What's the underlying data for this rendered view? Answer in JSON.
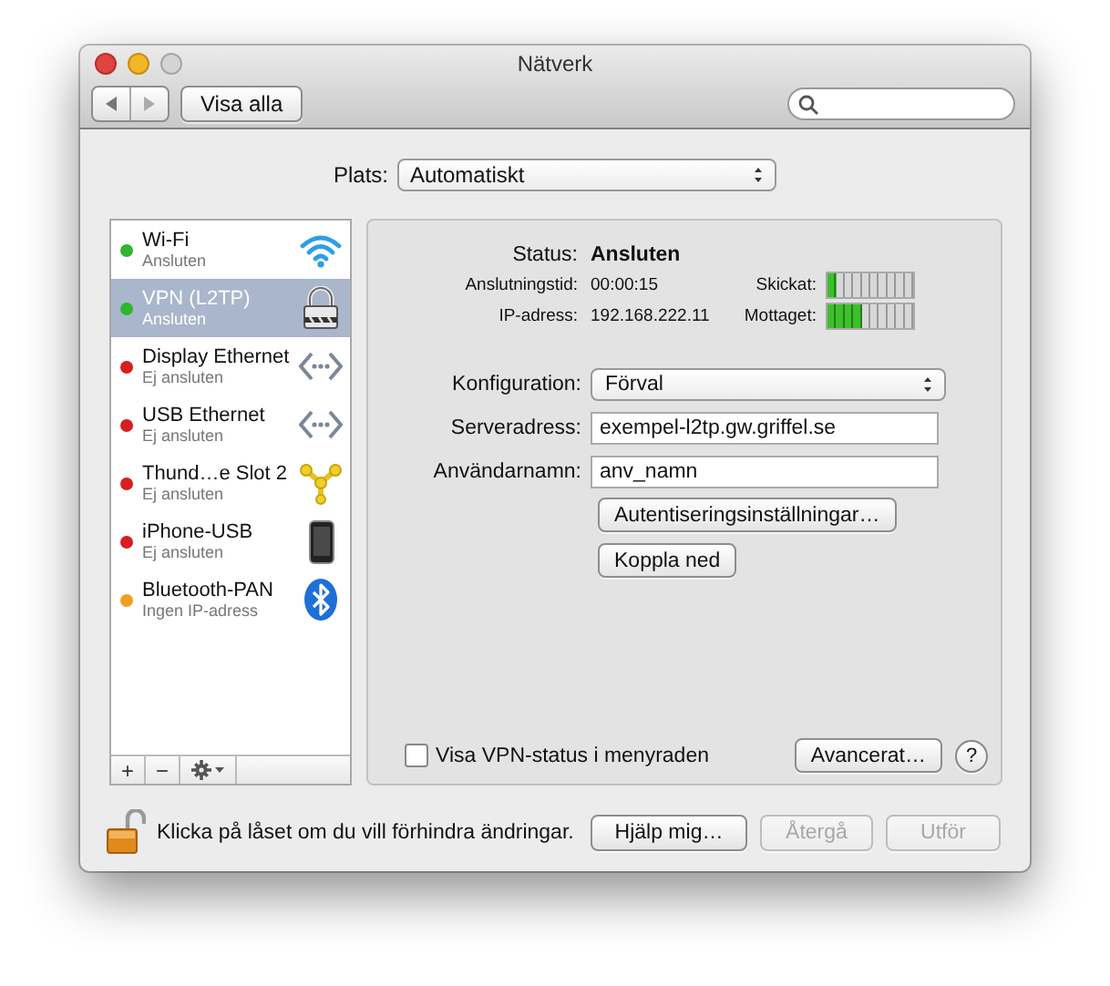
{
  "window": {
    "title": "Nätverk"
  },
  "toolbar": {
    "show_all": "Visa alla"
  },
  "location": {
    "label": "Plats:",
    "value": "Automatiskt"
  },
  "services": [
    {
      "name": "Wi-Fi",
      "status": "Ansluten",
      "color": "#2fb52f",
      "kind": "wifi",
      "selected": false
    },
    {
      "name": "VPN (L2TP)",
      "status": "Ansluten",
      "color": "#2fb52f",
      "kind": "vpn",
      "selected": true
    },
    {
      "name": "Display Ethernet",
      "status": "Ej ansluten",
      "color": "#d81e1e",
      "kind": "ethernet",
      "selected": false
    },
    {
      "name": "USB Ethernet",
      "status": "Ej ansluten",
      "color": "#d81e1e",
      "kind": "ethernet",
      "selected": false
    },
    {
      "name": "Thund…e Slot 2",
      "status": "Ej ansluten",
      "color": "#d81e1e",
      "kind": "firewire",
      "selected": false
    },
    {
      "name": "iPhone-USB",
      "status": "Ej ansluten",
      "color": "#d81e1e",
      "kind": "phone",
      "selected": false
    },
    {
      "name": "Bluetooth-PAN",
      "status": "Ingen IP-adress",
      "color": "#f0a020",
      "kind": "bluetooth",
      "selected": false
    }
  ],
  "sidebar_tools": [
    "+",
    "−"
  ],
  "status": {
    "label": "Status:",
    "value": "Ansluten",
    "rows": [
      {
        "label": "Anslutningstid:",
        "value": "00:00:15"
      },
      {
        "label": "IP-adress:",
        "value": "192.168.222.11"
      }
    ],
    "meters": [
      {
        "label": "Skickat:",
        "level": 0.1
      },
      {
        "label": "Mottaget:",
        "level": 0.4
      }
    ]
  },
  "config": {
    "label": "Konfiguration:",
    "value": "Förval"
  },
  "fields": [
    {
      "label": "Serveradress:",
      "value": "exempel-l2tp.gw.griffel.se"
    },
    {
      "label": "Användarnamn:",
      "value": "anv_namn"
    }
  ],
  "actions": [
    "Autentiseringsinställningar…",
    "Koppla ned"
  ],
  "menubar_checkbox": {
    "label": "Visa VPN-status i menyraden",
    "checked": false
  },
  "advanced": "Avancerat…",
  "help": "?",
  "lock": {
    "text": "Klicka på låset om du vill förhindra ändringar.",
    "locked": false
  },
  "buttons": [
    {
      "label": "Hjälp mig…",
      "disabled": false
    },
    {
      "label": "Återgå",
      "disabled": true
    },
    {
      "label": "Utför",
      "disabled": true
    }
  ]
}
